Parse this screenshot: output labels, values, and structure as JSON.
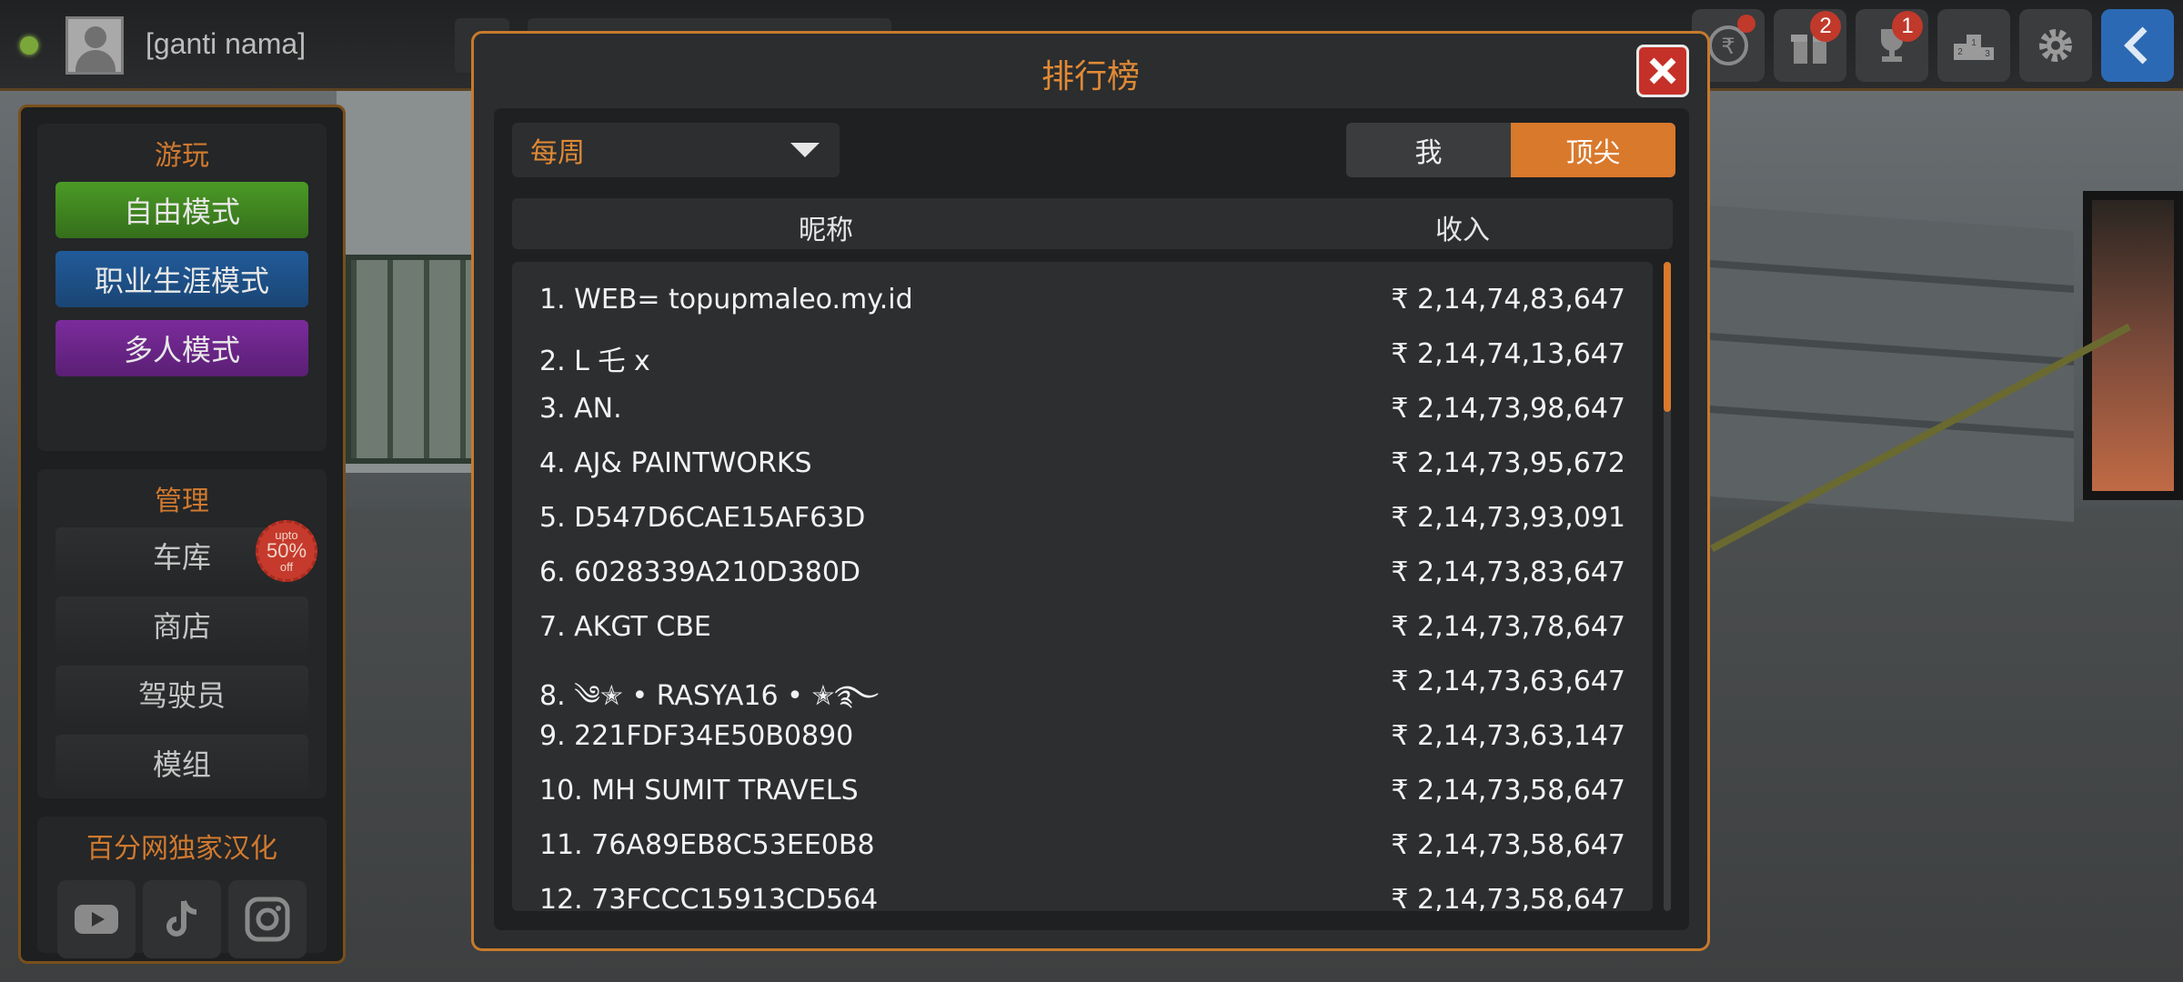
{
  "header": {
    "player_name": "[ganti nama]",
    "icons": [
      {
        "name": "rupee-coin-icon",
        "badge": ""
      },
      {
        "name": "gift-icon",
        "badge": "2"
      },
      {
        "name": "trophy-icon",
        "badge": "1"
      },
      {
        "name": "podium-icon",
        "badge": ""
      },
      {
        "name": "gear-icon",
        "badge": ""
      },
      {
        "name": "back-arrow-icon",
        "badge": ""
      }
    ]
  },
  "sidebar": {
    "play_title": "游玩",
    "free_mode": "自由模式",
    "career_mode": "职业生涯模式",
    "multiplayer": "多人模式",
    "manage_title": "管理",
    "garage": "车库",
    "sale": {
      "upto": "upto",
      "pct": "50%",
      "off": "off"
    },
    "shop": "商店",
    "drivers": "驾驶员",
    "mods": "模组",
    "credit_title": "百分网独家汉化"
  },
  "leaderboard": {
    "title": "排行榜",
    "period": "每周",
    "toggle_me": "我",
    "toggle_top": "顶尖",
    "col_name": "昵称",
    "col_income": "收入",
    "rows": [
      {
        "name": "1. WEB= topupmaleo.my.id",
        "income": "₹ 2,14,74,83,647"
      },
      {
        "name": "2. L 乇 x",
        "income": "₹ 2,14,74,13,647"
      },
      {
        "name": "3. AN.",
        "income": "₹ 2,14,73,98,647"
      },
      {
        "name": "4. AJ& PAINTWORKS",
        "income": "₹ 2,14,73,95,672"
      },
      {
        "name": "5. D547D6CAE15AF63D",
        "income": "₹ 2,14,73,93,091"
      },
      {
        "name": "6. 6028339A210D380D",
        "income": "₹ 2,14,73,83,647"
      },
      {
        "name": "7. AKGT CBE",
        "income": "₹ 2,14,73,78,647"
      },
      {
        "name": "8. ༄✭ • RASYA16 • ✭࿐",
        "income": "₹ 2,14,73,63,647"
      },
      {
        "name": "9. 221FDF34E50B0890",
        "income": "₹ 2,14,73,63,147"
      },
      {
        "name": "10. MH SUMIT TRAVELS",
        "income": "₹ 2,14,73,58,647"
      },
      {
        "name": "11. 76A89EB8C53EE0B8",
        "income": "₹ 2,14,73,58,647"
      },
      {
        "name": "12. 73FCCC15913CD564",
        "income": "₹ 2,14,73,58,647"
      }
    ]
  }
}
